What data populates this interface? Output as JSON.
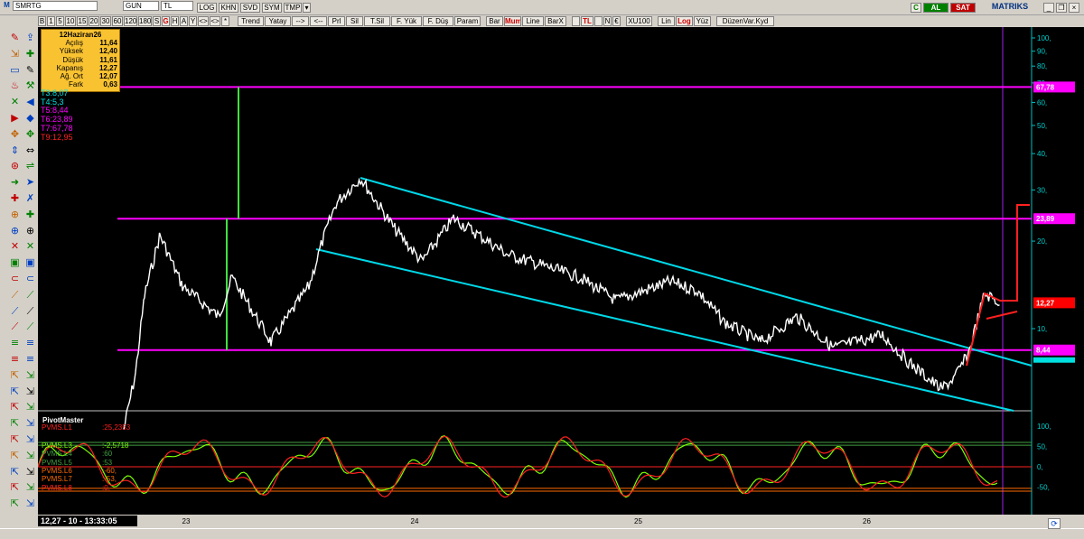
{
  "toolbar1": {
    "logo_letter": "M",
    "symbol": "SMRTG",
    "period": "GUN",
    "currency": "TL",
    "buttons": [
      "LOG",
      "KHN",
      "SVD",
      "SYM",
      "TMP"
    ],
    "right_items": [
      "C",
      "AL",
      "SAT",
      "MATRIKS"
    ]
  },
  "toolbar2": {
    "periods": [
      "B",
      "1",
      "5",
      "10",
      "15",
      "20",
      "30",
      "60",
      "120",
      "180",
      "S",
      "G",
      "H",
      "A",
      "Y",
      "<>",
      "<>",
      "*"
    ],
    "tools": [
      "Trend",
      "Yatay",
      "-->",
      "<--",
      "Prl",
      "Sil",
      "T.Sil",
      "F. Yük",
      "F. Düş",
      "Param",
      "Bar",
      "Mum",
      "Line",
      "BarX",
      "",
      "TL",
      "",
      "N",
      "€",
      "XU100",
      "Lin",
      "Log",
      "Yüz",
      "DüzenVar.Kyd"
    ]
  },
  "ohlc_box": {
    "date": "12Haziran26",
    "rows": [
      {
        "label": "Açılış",
        "value": "11,64"
      },
      {
        "label": "Yüksek",
        "value": "12,40"
      },
      {
        "label": "Düşük",
        "value": "11,61"
      },
      {
        "label": "Kapanış",
        "value": "12,27"
      },
      {
        "label": "Ağ. Ort",
        "value": "12,07"
      },
      {
        "label": "Fark",
        "value": "0,63"
      }
    ]
  },
  "trend_labels": [
    {
      "text": "T3:8,07",
      "color": "#00e0e0"
    },
    {
      "text": "T4:5,3",
      "color": "#00e0e0"
    },
    {
      "text": "T5:8,44",
      "color": "#ff00ff"
    },
    {
      "text": "T6:23,89",
      "color": "#ff00ff"
    },
    {
      "text": "T7:67,78",
      "color": "#ff00ff"
    },
    {
      "text": "T9:12,95",
      "color": "#ff2020"
    }
  ],
  "price_axis": {
    "ticks": [
      "100,",
      "90,",
      "80,",
      "70,",
      "60,",
      "50,",
      "40,",
      "30,",
      "20,",
      "10,"
    ],
    "tick_values": [
      100,
      90,
      80,
      70,
      60,
      50,
      40,
      30,
      20,
      10
    ],
    "levels": [
      {
        "label": "67,78",
        "value": 67.78,
        "color": "#ff00ff"
      },
      {
        "label": "23,89",
        "value": 23.89,
        "color": "#ff00ff"
      },
      {
        "label": "12,27",
        "value": 12.27,
        "color": "#ff0000"
      },
      {
        "label": "8,44",
        "value": 8.44,
        "color": "#ff00ff"
      }
    ]
  },
  "indicator": {
    "title": "PivotMaster",
    "lines": [
      {
        "name": "PVMS.L1",
        "value": ":25,2353",
        "color": "#ff2020"
      },
      {
        "name": "PVMS.L3",
        "value": ":-2,5718",
        "color": "#7cff00"
      },
      {
        "name": "PVMS.L4",
        "value": ":60",
        "color": "#40a040"
      },
      {
        "name": "PVMS.L5",
        "value": ":53",
        "color": "#40a040"
      },
      {
        "name": "PVMS.L6",
        "value": ":-60,",
        "color": "#ff6a00"
      },
      {
        "name": "PVMS.L7",
        "value": ":-53,",
        "color": "#ff6a00"
      },
      {
        "name": "PVMS.L8",
        "value": ":0,",
        "color": "#ff2020"
      }
    ],
    "ticks": [
      "100,",
      "50,",
      "0,",
      "-50,"
    ],
    "tick_values": [
      100,
      50,
      0,
      -50
    ]
  },
  "time_axis": {
    "labels": [
      "23",
      "24",
      "25",
      "26"
    ],
    "label_fraction": [
      0.145,
      0.375,
      0.6,
      0.83
    ]
  },
  "status": {
    "readout": "12,27 - 10 - 13:33:05"
  }
}
